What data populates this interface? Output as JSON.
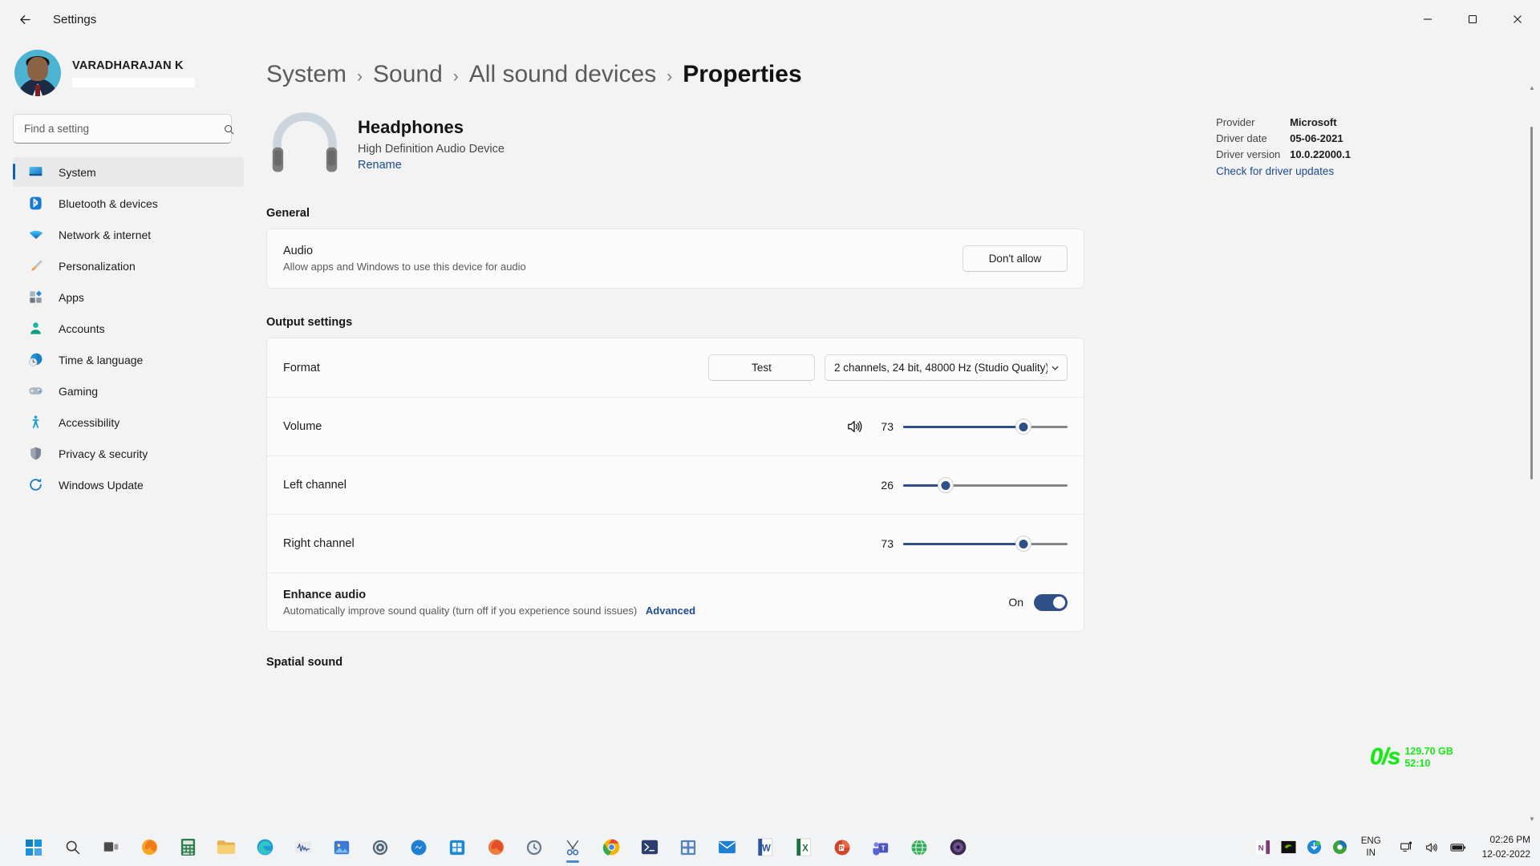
{
  "titlebar": {
    "back_label": "back-arrow",
    "app_title": "Settings",
    "minimize": "minimize",
    "maximize": "maximize",
    "close": "close"
  },
  "sidebar": {
    "profile": {
      "name": "VARADHARAJAN K",
      "email_redacted": ""
    },
    "search": {
      "placeholder": "Find a setting",
      "value": ""
    },
    "items": [
      {
        "label": "System",
        "icon": "monitor-icon",
        "active": true
      },
      {
        "label": "Bluetooth & devices",
        "icon": "bluetooth-icon",
        "active": false
      },
      {
        "label": "Network & internet",
        "icon": "wifi-icon",
        "active": false
      },
      {
        "label": "Personalization",
        "icon": "paintbrush-icon",
        "active": false
      },
      {
        "label": "Apps",
        "icon": "apps-icon",
        "active": false
      },
      {
        "label": "Accounts",
        "icon": "person-icon",
        "active": false
      },
      {
        "label": "Time & language",
        "icon": "globe-clock-icon",
        "active": false
      },
      {
        "label": "Gaming",
        "icon": "gamepad-icon",
        "active": false
      },
      {
        "label": "Accessibility",
        "icon": "accessibility-icon",
        "active": false
      },
      {
        "label": "Privacy & security",
        "icon": "shield-icon",
        "active": false
      },
      {
        "label": "Windows Update",
        "icon": "update-icon",
        "active": false
      }
    ]
  },
  "breadcrumb": [
    {
      "label": "System",
      "current": false
    },
    {
      "label": "Sound",
      "current": false
    },
    {
      "label": "All sound devices",
      "current": false
    },
    {
      "label": "Properties",
      "current": true
    }
  ],
  "device": {
    "name": "Headphones",
    "subtitle": "High Definition Audio Device",
    "rename_label": "Rename",
    "icon": "headphones-icon"
  },
  "driver": {
    "provider_label": "Provider",
    "provider_value": "Microsoft",
    "date_label": "Driver date",
    "date_value": "05-06-2021",
    "version_label": "Driver version",
    "version_value": "10.0.22000.1",
    "check_updates_link": "Check for driver updates"
  },
  "general": {
    "section_title": "General",
    "audio": {
      "title": "Audio",
      "subtitle": "Allow apps and Windows to use this device for audio",
      "button_label": "Don't allow"
    }
  },
  "output_settings": {
    "section_title": "Output settings",
    "format": {
      "title": "Format",
      "test_label": "Test",
      "selected_option": "2 channels, 24 bit, 48000 Hz (Studio Quality)",
      "chevron": "chevron-down-icon"
    },
    "volume": {
      "title": "Volume",
      "icon": "speaker-icon",
      "value": 73,
      "min": 0,
      "max": 100
    },
    "left_channel": {
      "title": "Left channel",
      "value": 26,
      "min": 0,
      "max": 100
    },
    "right_channel": {
      "title": "Right channel",
      "value": 73,
      "min": 0,
      "max": 100
    },
    "enhance_audio": {
      "title": "Enhance audio",
      "subtitle": "Automatically improve sound quality (turn off if you experience sound issues)",
      "advanced_link": "Advanced",
      "toggle_state_label": "On",
      "toggle_on": true
    }
  },
  "spatial_sound": {
    "section_title": "Spatial sound"
  },
  "net_overlay": {
    "speed": "0/s",
    "data_used": "129.70 GB",
    "uptime": "52:10",
    "color": "#18e818"
  },
  "taskbar": {
    "items": [
      {
        "name": "start-button",
        "icon": "windows-logo-icon"
      },
      {
        "name": "search-button",
        "icon": "search-icon"
      },
      {
        "name": "task-view-button",
        "icon": "task-view-icon"
      },
      {
        "name": "firefox-button",
        "icon": "firefox-icon"
      },
      {
        "name": "calculator-button",
        "icon": "calculator-icon"
      },
      {
        "name": "file-explorer-button",
        "icon": "folder-icon"
      },
      {
        "name": "edge-button",
        "icon": "edge-icon"
      },
      {
        "name": "audacity-button",
        "icon": "waveform-icon"
      },
      {
        "name": "photos-button",
        "icon": "photos-icon"
      },
      {
        "name": "settings-button",
        "icon": "gear-icon"
      },
      {
        "name": "messenger-button",
        "icon": "messenger-icon"
      },
      {
        "name": "store-button",
        "icon": "store-icon"
      },
      {
        "name": "firefox2-button",
        "icon": "firefox-icon"
      },
      {
        "name": "clock-app-button",
        "icon": "clock-icon"
      },
      {
        "name": "snipping-tool-button",
        "icon": "snip-icon",
        "active": true
      },
      {
        "name": "chrome-button",
        "icon": "chrome-icon"
      },
      {
        "name": "powershell-button",
        "icon": "terminal-icon"
      },
      {
        "name": "calculator2-button",
        "icon": "grid-icon"
      },
      {
        "name": "mail-button",
        "icon": "mail-icon"
      },
      {
        "name": "word-button",
        "icon": "word-icon"
      },
      {
        "name": "excel-button",
        "icon": "excel-icon"
      },
      {
        "name": "powerpoint-button",
        "icon": "powerpoint-icon"
      },
      {
        "name": "teams-button",
        "icon": "teams-icon"
      },
      {
        "name": "chrome2-button",
        "icon": "globe-icon"
      },
      {
        "name": "media-player-button",
        "icon": "media-icon"
      }
    ],
    "tray": {
      "icons": [
        {
          "name": "onenote-tray-icon",
          "glyph": "N"
        },
        {
          "name": "nvidia-tray-icon",
          "glyph": "◉"
        },
        {
          "name": "idm-tray-icon",
          "glyph": "◐"
        },
        {
          "name": "realplayer-tray-icon",
          "glyph": "●"
        }
      ],
      "language": {
        "line1": "ENG",
        "line2": "IN"
      },
      "network_icon": "network-icon",
      "volume_icon": "volume-icon",
      "battery_icon": "battery-icon",
      "clock": {
        "time": "02:26 PM",
        "date": "12-02-2022"
      }
    }
  }
}
